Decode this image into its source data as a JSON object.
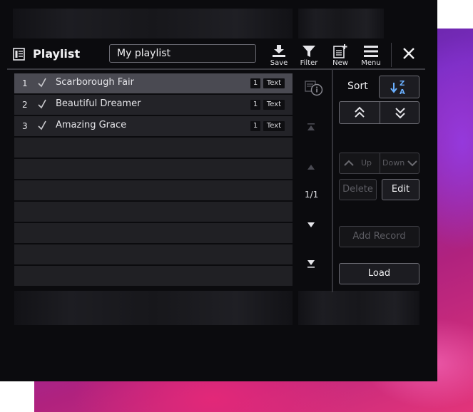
{
  "header": {
    "title": "Playlist",
    "playlist_name": "My playlist",
    "toolbar": {
      "save": "Save",
      "filter": "Filter",
      "new": "New",
      "menu": "Menu"
    }
  },
  "songs": [
    {
      "num": "1",
      "title": "Scarborough Fair",
      "count": "1",
      "type": "Text"
    },
    {
      "num": "2",
      "title": "Beautiful Dreamer",
      "count": "1",
      "type": "Text"
    },
    {
      "num": "3",
      "title": "Amazing Grace",
      "count": "1",
      "type": "Text"
    }
  ],
  "pagination": "1/1",
  "controls": {
    "sort_label": "Sort",
    "up": "Up",
    "down": "Down",
    "delete": "Delete",
    "edit": "Edit",
    "add_record": "Add Record",
    "load": "Load"
  },
  "icons": {
    "playlist": "playlist-icon",
    "save": "save-icon",
    "filter": "filter-icon",
    "new": "new-icon",
    "menu": "menu-icon",
    "close": "close-icon",
    "info": "info-icon",
    "sort": "sort-za-icon"
  },
  "colors": {
    "panel": "#0b0b0e",
    "row": "#232328",
    "row_selected": "#4a4a52",
    "art_accent": "#b0227e"
  }
}
